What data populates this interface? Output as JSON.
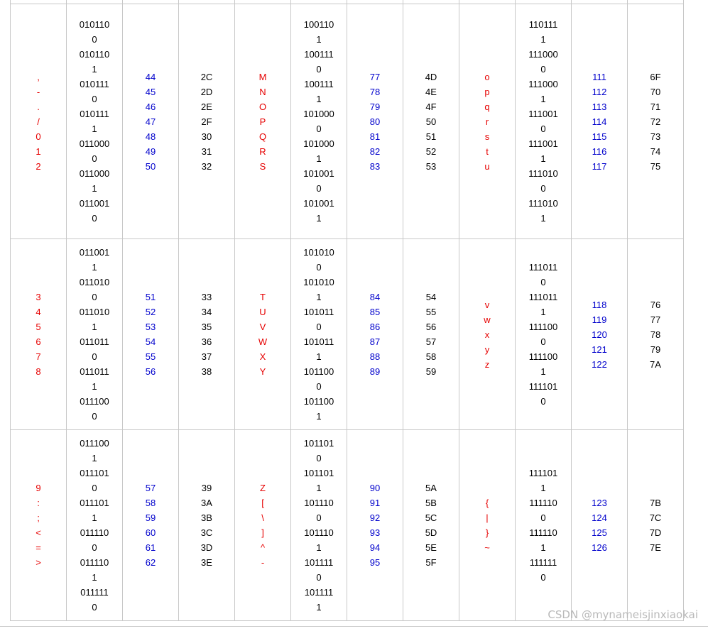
{
  "rows": [
    {
      "chars1": [
        ",",
        "-",
        ".",
        "/",
        "0",
        "1",
        "2"
      ],
      "bin1": [
        "010110",
        "0",
        "010110",
        "1",
        "010111",
        "0",
        "010111",
        "1",
        "011000",
        "0",
        "011000",
        "1",
        "011001",
        "0"
      ],
      "dec1": [
        "44",
        "45",
        "46",
        "47",
        "48",
        "49",
        "50"
      ],
      "hex1": [
        "2C",
        "2D",
        "2E",
        "2F",
        "30",
        "31",
        "32"
      ],
      "chars2": [
        "M",
        "N",
        "O",
        "P",
        "Q",
        "R",
        "S"
      ],
      "bin2": [
        "100110",
        "1",
        "100111",
        "0",
        "100111",
        "1",
        "101000",
        "0",
        "101000",
        "1",
        "101001",
        "0",
        "101001",
        "1"
      ],
      "dec2": [
        "77",
        "78",
        "79",
        "80",
        "81",
        "82",
        "83"
      ],
      "hex2": [
        "4D",
        "4E",
        "4F",
        "50",
        "51",
        "52",
        "53"
      ],
      "chars3": [
        "o",
        "p",
        "q",
        "r",
        "s",
        "t",
        "u"
      ],
      "bin3": [
        "110111",
        "1",
        "111000",
        "0",
        "111000",
        "1",
        "111001",
        "0",
        "111001",
        "1",
        "111010",
        "0",
        "111010",
        "1"
      ],
      "dec3": [
        "111",
        "112",
        "113",
        "114",
        "115",
        "116",
        "117"
      ],
      "hex3": [
        "6F",
        "70",
        "71",
        "72",
        "73",
        "74",
        "75"
      ]
    },
    {
      "chars1": [
        "3",
        "4",
        "5",
        "6",
        "7",
        "8"
      ],
      "bin1": [
        "011001",
        "1",
        "011010",
        "0",
        "011010",
        "1",
        "011011",
        "0",
        "011011",
        "1",
        "011100",
        "0"
      ],
      "dec1": [
        "51",
        "52",
        "53",
        "54",
        "55",
        "56"
      ],
      "hex1": [
        "33",
        "34",
        "35",
        "36",
        "37",
        "38"
      ],
      "chars2": [
        "T",
        "U",
        "V",
        "W",
        "X",
        "Y"
      ],
      "bin2": [
        "101010",
        "0",
        "101010",
        "1",
        "101011",
        "0",
        "101011",
        "1",
        "101100",
        "0",
        "101100",
        "1"
      ],
      "dec2": [
        "84",
        "85",
        "86",
        "87",
        "88",
        "89"
      ],
      "hex2": [
        "54",
        "55",
        "56",
        "57",
        "58",
        "59"
      ],
      "chars3": [
        "v",
        "w",
        "x",
        "y",
        "z"
      ],
      "bin3": [
        "111011",
        "0",
        "111011",
        "1",
        "111100",
        "0",
        "111100",
        "1",
        "111101",
        "0"
      ],
      "dec3": [
        "118",
        "119",
        "120",
        "121",
        "122"
      ],
      "hex3": [
        "76",
        "77",
        "78",
        "79",
        "7A"
      ]
    },
    {
      "chars1": [
        "9",
        ":",
        ";",
        "<",
        "=",
        ">"
      ],
      "bin1": [
        "011100",
        "1",
        "011101",
        "0",
        "011101",
        "1",
        "011110",
        "0",
        "011110",
        "1",
        "011111",
        "0"
      ],
      "dec1": [
        "57",
        "58",
        "59",
        "60",
        "61",
        "62"
      ],
      "hex1": [
        "39",
        "3A",
        "3B",
        "3C",
        "3D",
        "3E"
      ],
      "chars2": [
        "Z",
        "[",
        "\\",
        "]",
        "^",
        "-"
      ],
      "bin2": [
        "101101",
        "0",
        "101101",
        "1",
        "101110",
        "0",
        "101110",
        "1",
        "101111",
        "0",
        "101111",
        "1"
      ],
      "dec2": [
        "90",
        "91",
        "92",
        "93",
        "94",
        "95"
      ],
      "hex2": [
        "5A",
        "5B",
        "5C",
        "5D",
        "5E",
        "5F"
      ],
      "chars3": [
        "{",
        "|",
        "}",
        "~"
      ],
      "bin3": [
        "111101",
        "1",
        "111110",
        "0",
        "111110",
        "1",
        "111111",
        "0"
      ],
      "dec3": [
        "123",
        "124",
        "125",
        "126"
      ],
      "hex3": [
        "7B",
        "7C",
        "7D",
        "7E"
      ]
    }
  ],
  "colors": {
    "char": "#e60000",
    "decimal": "#0000cc",
    "text": "#000000",
    "border": "#c8c8c8",
    "watermark": "#b9b9b9"
  },
  "watermark": "CSDN @mynameisjinxiaokai"
}
